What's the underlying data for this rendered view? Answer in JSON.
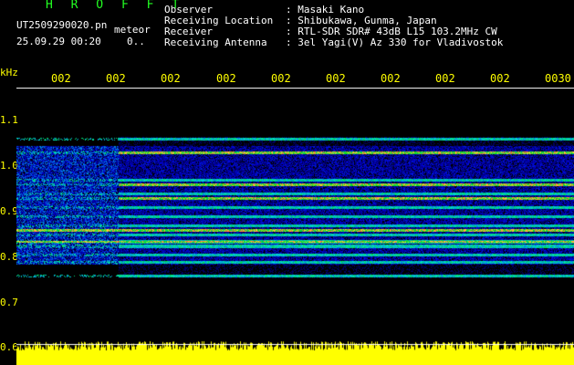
{
  "header": {
    "brand": "H R O F F T",
    "filename": "UT2509290020.pn",
    "meteor_label": "meteor",
    "datetime": "25.09.29 00:20",
    "counter": "0..",
    "observer_label": "Observer",
    "observer_value": ": Masaki Kano",
    "location_label": "Receiving Location",
    "location_value": ": Shibukawa, Gunma, Japan",
    "receiver_label": "Receiver",
    "receiver_value": ": RTL-SDR SDR# 43dB L15 103.2MHz CW",
    "antenna_label": "Receiving Antenna",
    "antenna_value": ": 3el Yagi(V) Az 330 for Vladivostok"
  },
  "axis": {
    "unit": "kHz",
    "y_ticks": [
      "1.1",
      "1.0",
      "0.9",
      "0.8",
      "0.7",
      "0.6"
    ],
    "time_ticks": [
      "002",
      "002",
      "002",
      "002",
      "002",
      "002",
      "002",
      "002",
      "002",
      "0030"
    ]
  },
  "colors": {
    "background": "#000000",
    "axis_text": "#ffff00",
    "brand": "#22ff22",
    "audio_trace": "#ffff00"
  },
  "spectrogram": {
    "freq_range_khz": [
      0.6,
      1.15
    ],
    "time_range": [
      "00:20",
      "00:30"
    ],
    "bands_khz": [
      1.045,
      1.015,
      0.955,
      0.945,
      0.925,
      0.915,
      0.895,
      0.875,
      0.855,
      0.845,
      0.835,
      0.82,
      0.81,
      0.79,
      0.775,
      0.745
    ],
    "strong_bands_khz": [
      0.945,
      0.915,
      0.845,
      0.82,
      1.015
    ]
  }
}
